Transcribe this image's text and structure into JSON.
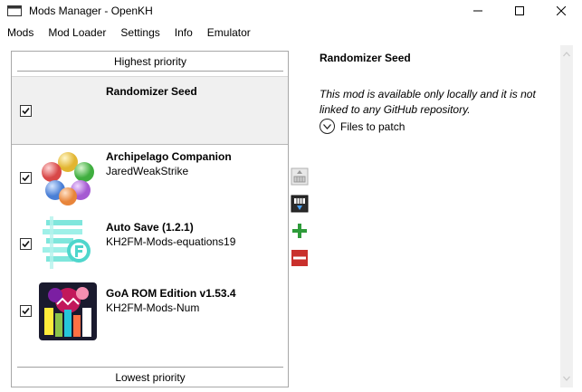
{
  "window": {
    "title": "Mods Manager - OpenKH",
    "icon": "window-app-icon"
  },
  "menu": {
    "items": [
      {
        "label": "Mods"
      },
      {
        "label": "Mod Loader"
      },
      {
        "label": "Settings"
      },
      {
        "label": "Info"
      },
      {
        "label": "Emulator"
      }
    ]
  },
  "modlist": {
    "top_label": "Highest priority",
    "bottom_label": "Lowest priority",
    "mods": [
      {
        "name": "Randomizer Seed",
        "author": "",
        "checked": true,
        "selected": true,
        "thumb": "none"
      },
      {
        "name": "Archipelago Companion",
        "author": "JaredWeakStrike",
        "checked": true,
        "selected": false,
        "thumb": "orbs-icon"
      },
      {
        "name": "Auto Save (1.2.1)",
        "author": "KH2FM-Mods-equations19",
        "checked": true,
        "selected": false,
        "thumb": "autosave-icon"
      },
      {
        "name": "GoA ROM Edition v1.53.4",
        "author": "KH2FM-Mods-Num",
        "checked": true,
        "selected": false,
        "thumb": "goa-art-icon"
      }
    ]
  },
  "side_buttons": [
    {
      "name": "move-up-button",
      "icon": "move-up-icon"
    },
    {
      "name": "move-down-button",
      "icon": "move-down-icon"
    },
    {
      "name": "add-mod-button",
      "icon": "plus-icon"
    },
    {
      "name": "remove-mod-button",
      "icon": "minus-icon"
    }
  ],
  "detail": {
    "title": "Randomizer Seed",
    "description": "This mod is available only locally and it is not linked to any GitHub repository.",
    "files_label": "Files to patch"
  },
  "colors": {
    "add_green": "#2e9b3a",
    "remove_red": "#c9302c",
    "selected_bg": "#f0f0f0"
  }
}
